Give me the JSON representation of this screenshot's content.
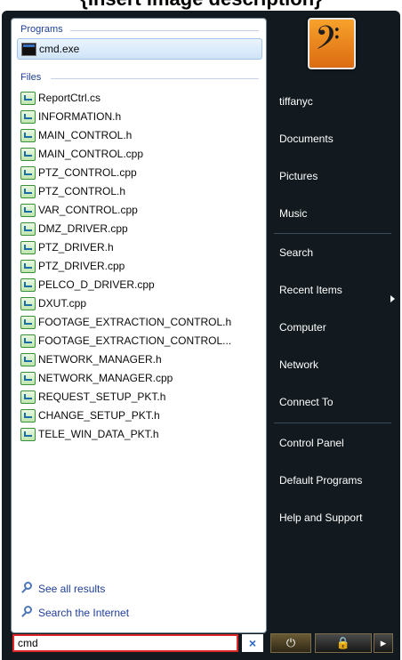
{
  "caption": "{Insert image description}",
  "programs_header": "Programs",
  "files_header": "Files",
  "programs": [
    {
      "label": "cmd.exe",
      "icon": "cmd-icon"
    }
  ],
  "files": [
    {
      "label": "ReportCtrl.cs"
    },
    {
      "label": "INFORMATION.h"
    },
    {
      "label": "MAIN_CONTROL.h"
    },
    {
      "label": "MAIN_CONTROL.cpp"
    },
    {
      "label": "PTZ_CONTROL.cpp"
    },
    {
      "label": "PTZ_CONTROL.h"
    },
    {
      "label": "VAR_CONTROL.cpp"
    },
    {
      "label": "DMZ_DRIVER.cpp"
    },
    {
      "label": "PTZ_DRIVER.h"
    },
    {
      "label": "PTZ_DRIVER.cpp"
    },
    {
      "label": "PELCO_D_DRIVER.cpp"
    },
    {
      "label": "DXUT.cpp"
    },
    {
      "label": "FOOTAGE_EXTRACTION_CONTROL.h"
    },
    {
      "label": "FOOTAGE_EXTRACTION_CONTROL..."
    },
    {
      "label": "NETWORK_MANAGER.h"
    },
    {
      "label": "NETWORK_MANAGER.cpp"
    },
    {
      "label": "REQUEST_SETUP_PKT.h"
    },
    {
      "label": "CHANGE_SETUP_PKT.h"
    },
    {
      "label": "TELE_WIN_DATA_PKT.h"
    }
  ],
  "see_all_results": "See all results",
  "search_internet": "Search the Internet",
  "search": {
    "value": "cmd",
    "clear": "×"
  },
  "right_menu": {
    "user": "tiffanyc",
    "documents": "Documents",
    "pictures": "Pictures",
    "music": "Music",
    "search": "Search",
    "recent_items": "Recent Items",
    "computer": "Computer",
    "network": "Network",
    "connect_to": "Connect To",
    "control_panel": "Control Panel",
    "default_programs": "Default Programs",
    "help_support": "Help and Support"
  },
  "power_buttons": {
    "power": "⏻",
    "lock": "🔒",
    "more": "▸"
  }
}
